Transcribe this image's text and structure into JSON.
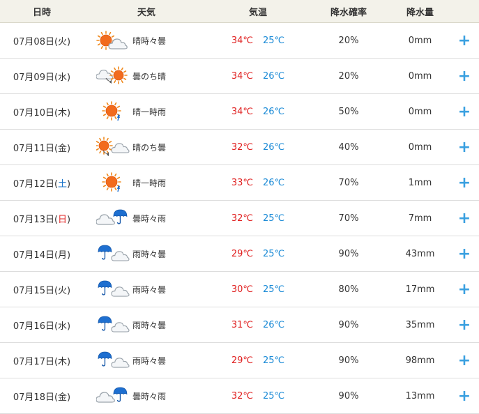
{
  "header": {
    "date": "日時",
    "weather": "天気",
    "temp": "気温",
    "pop": "降水確率",
    "amount": "降水量"
  },
  "colors": {
    "high": "#e02020",
    "low": "#1a8ad6",
    "saturday": "#1a73c9",
    "sunday": "#e02020",
    "plus": "#3aa0e0"
  },
  "plus_symbol": "+",
  "rows": [
    {
      "date": "07月08日(",
      "wd": "火",
      "wd_type": "",
      "close": ")",
      "icon": "sun-cloud",
      "weather": "晴時々曇",
      "hi": "34℃",
      "lo": "25℃",
      "pop": "20%",
      "amt": "0mm"
    },
    {
      "date": "07月09日(",
      "wd": "水",
      "wd_type": "",
      "close": ")",
      "icon": "cloud-then-sun",
      "weather": "曇のち晴",
      "hi": "34℃",
      "lo": "26℃",
      "pop": "20%",
      "amt": "0mm"
    },
    {
      "date": "07月10日(",
      "wd": "木",
      "wd_type": "",
      "close": ")",
      "icon": "sun-rain",
      "weather": "晴一時雨",
      "hi": "34℃",
      "lo": "26℃",
      "pop": "50%",
      "amt": "0mm"
    },
    {
      "date": "07月11日(",
      "wd": "金",
      "wd_type": "",
      "close": ")",
      "icon": "sun-then-cloud",
      "weather": "晴のち曇",
      "hi": "32℃",
      "lo": "26℃",
      "pop": "40%",
      "amt": "0mm"
    },
    {
      "date": "07月12日(",
      "wd": "土",
      "wd_type": "sat",
      "close": ")",
      "icon": "sun-rain",
      "weather": "晴一時雨",
      "hi": "33℃",
      "lo": "26℃",
      "pop": "70%",
      "amt": "1mm"
    },
    {
      "date": "07月13日(",
      "wd": "日",
      "wd_type": "sun",
      "close": ")",
      "icon": "cloud-umbrella",
      "weather": "曇時々雨",
      "hi": "32℃",
      "lo": "25℃",
      "pop": "70%",
      "amt": "7mm"
    },
    {
      "date": "07月14日(",
      "wd": "月",
      "wd_type": "",
      "close": ")",
      "icon": "umbrella-cloud",
      "weather": "雨時々曇",
      "hi": "29℃",
      "lo": "25℃",
      "pop": "90%",
      "amt": "43mm"
    },
    {
      "date": "07月15日(",
      "wd": "火",
      "wd_type": "",
      "close": ")",
      "icon": "umbrella-cloud",
      "weather": "雨時々曇",
      "hi": "30℃",
      "lo": "25℃",
      "pop": "80%",
      "amt": "17mm"
    },
    {
      "date": "07月16日(",
      "wd": "水",
      "wd_type": "",
      "close": ")",
      "icon": "umbrella-cloud",
      "weather": "雨時々曇",
      "hi": "31℃",
      "lo": "26℃",
      "pop": "90%",
      "amt": "35mm"
    },
    {
      "date": "07月17日(",
      "wd": "木",
      "wd_type": "",
      "close": ")",
      "icon": "umbrella-cloud",
      "weather": "雨時々曇",
      "hi": "29℃",
      "lo": "25℃",
      "pop": "90%",
      "amt": "98mm"
    },
    {
      "date": "07月18日(",
      "wd": "金",
      "wd_type": "",
      "close": ")",
      "icon": "cloud-umbrella",
      "weather": "曇時々雨",
      "hi": "32℃",
      "lo": "25℃",
      "pop": "90%",
      "amt": "13mm"
    }
  ]
}
